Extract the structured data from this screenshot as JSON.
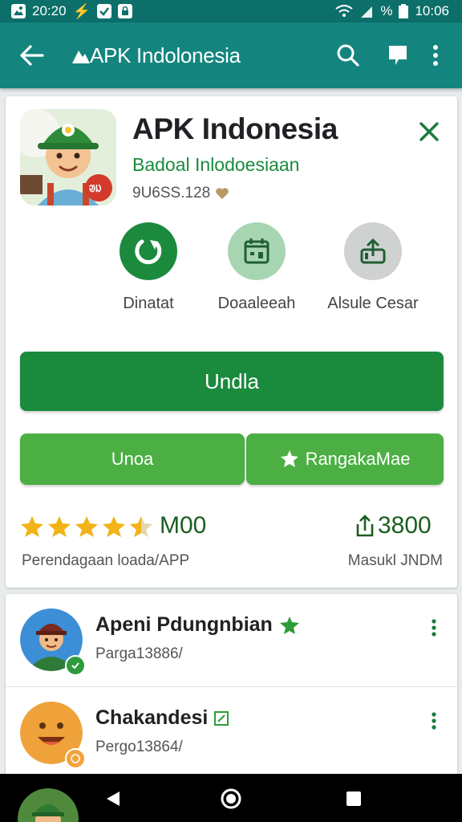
{
  "status_bar": {
    "time_left": "20:20",
    "battery_percent": "%",
    "time_right": "10:06"
  },
  "app_bar": {
    "title": "APK Indolonesia",
    "accent": "#14857e"
  },
  "app": {
    "name": "APK Indonesia",
    "developer": "Badoal Inlodoesiaan",
    "id": "9U6SS.128",
    "icon_badge": "ᱣᱡ"
  },
  "quick_actions": [
    {
      "label": "Dinatat",
      "icon": "refresh-arrow-icon"
    },
    {
      "label": "Doaaleeah",
      "icon": "calendar-icon"
    },
    {
      "label": "Alsule Cesar",
      "icon": "share-upload-icon"
    }
  ],
  "buttons": {
    "primary": "Undla",
    "secondary_left": "Unoa",
    "secondary_right": "RangakaMae"
  },
  "rating": {
    "stars": 4.5,
    "value": "M00",
    "caption": "Perendagaan  loada/APP"
  },
  "shares": {
    "value": "3800",
    "caption": "Masukl JNDM"
  },
  "users": [
    {
      "name": "Apeni Pdungnbian",
      "sub": "Parga13886/",
      "badge_color": "#2e9c3a"
    },
    {
      "name": "Chakandesi",
      "sub": "Pergo13864/",
      "badge_color": "#f2a33a"
    }
  ]
}
